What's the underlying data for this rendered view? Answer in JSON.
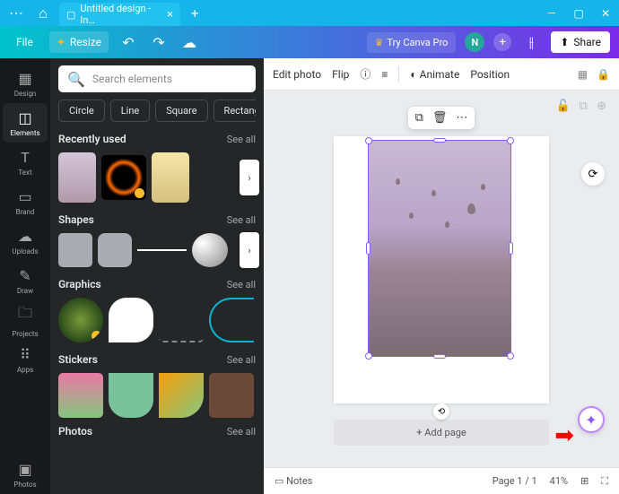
{
  "titlebar": {
    "tab_title": "Untitled design - In…"
  },
  "toolbar": {
    "file": "File",
    "resize": "Resize",
    "try_pro": "Try Canva Pro",
    "avatar_initial": "N",
    "share": "Share"
  },
  "rail": [
    {
      "label": "Design"
    },
    {
      "label": "Elements"
    },
    {
      "label": "Text"
    },
    {
      "label": "Brand"
    },
    {
      "label": "Uploads"
    },
    {
      "label": "Draw"
    },
    {
      "label": "Projects"
    },
    {
      "label": "Apps"
    },
    {
      "label": "Photos"
    }
  ],
  "panel": {
    "search_placeholder": "Search elements",
    "chips": [
      "Circle",
      "Line",
      "Square",
      "Rectang"
    ],
    "sections": {
      "recent": {
        "title": "Recently used",
        "see": "See all"
      },
      "shapes": {
        "title": "Shapes",
        "see": "See all"
      },
      "graphics": {
        "title": "Graphics",
        "see": "See all"
      },
      "stickers": {
        "title": "Stickers",
        "see": "See all"
      },
      "photos": {
        "title": "Photos",
        "see": "See all"
      }
    }
  },
  "context": {
    "edit_photo": "Edit photo",
    "flip": "Flip",
    "animate": "Animate",
    "position": "Position"
  },
  "canvas": {
    "add_page": "+ Add page"
  },
  "footer": {
    "notes": "Notes",
    "page": "Page 1 / 1",
    "zoom": "41%"
  }
}
